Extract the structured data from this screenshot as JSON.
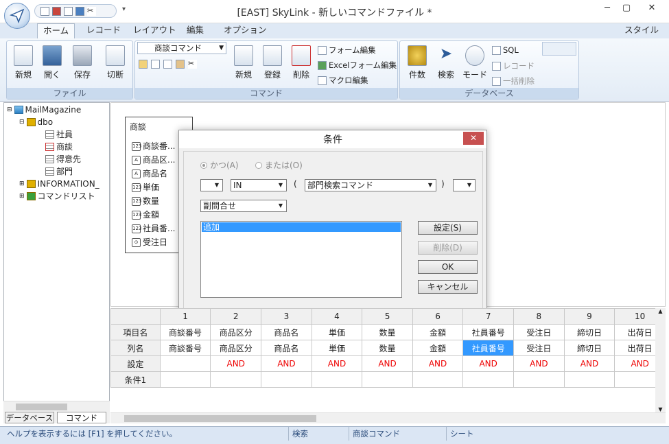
{
  "window": {
    "title": "[EAST] SkyLink - 新しいコマンドファイル *"
  },
  "ribbon_tabs": [
    "ホーム",
    "レコード",
    "レイアウト",
    "編集",
    "オプション"
  ],
  "style_menu": "スタイル",
  "groups": {
    "file": {
      "label": "ファイル",
      "buttons": [
        "新規",
        "開く",
        "保存",
        "切断"
      ]
    },
    "command": {
      "label": "コマンド",
      "combo": "商談コマンド",
      "buttons": [
        "新規",
        "登録",
        "削除"
      ],
      "links": [
        "フォーム編集",
        "Excelフォーム編集",
        "マクロ編集"
      ]
    },
    "database": {
      "label": "データベース",
      "buttons": [
        "件数",
        "検索",
        "モード"
      ],
      "links": [
        "SQL",
        "レコード",
        "一括削除"
      ]
    }
  },
  "tree": {
    "root": "MailMagazine",
    "schema": "dbo",
    "tables": [
      "社員",
      "商談",
      "得意先",
      "部門"
    ],
    "others": [
      "INFORMATION_",
      "コマンドリスト"
    ]
  },
  "left_tabs": [
    "データベース",
    "コマンド"
  ],
  "table_box": {
    "title": "商談",
    "fields": [
      {
        "icon": "123",
        "name": "商談番..."
      },
      {
        "icon": "A",
        "name": "商品区..."
      },
      {
        "icon": "A",
        "name": "商品名"
      },
      {
        "icon": "123",
        "name": "単価"
      },
      {
        "icon": "123",
        "name": "数量"
      },
      {
        "icon": "123",
        "name": "金額"
      },
      {
        "icon": "123",
        "name": "社員番..."
      },
      {
        "icon": "date",
        "name": "受注日"
      }
    ]
  },
  "dialog": {
    "title": "条件",
    "close": "✕",
    "radio_and": "かつ(A)",
    "radio_or": "または(O)",
    "open_paren": "(",
    "close_paren": ")",
    "operator": "IN",
    "target": "部門検索コマンド",
    "subquery": "副問合せ",
    "list_items": [
      "追加"
    ],
    "buttons": {
      "set": "設定(S)",
      "delete": "削除(D)",
      "ok": "OK",
      "cancel": "キャンセル"
    }
  },
  "grid": {
    "columns": [
      "1",
      "2",
      "3",
      "4",
      "5",
      "6",
      "7",
      "8",
      "9",
      "10"
    ],
    "row_labels": [
      "項目名",
      "列名",
      "設定",
      "条件1"
    ],
    "item_names": [
      "商談番号",
      "商品区分",
      "商品名",
      "単価",
      "数量",
      "金額",
      "社員番号",
      "受注日",
      "締切日",
      "出荷日"
    ],
    "col_names": [
      "商談番号",
      "商品区分",
      "商品名",
      "単価",
      "数量",
      "金額",
      "社員番号",
      "受注日",
      "締切日",
      "出荷日"
    ],
    "settings": [
      "",
      "AND",
      "AND",
      "AND",
      "AND",
      "AND",
      "AND",
      "AND",
      "AND",
      "AND"
    ]
  },
  "status": {
    "help": "ヘルプを表示するには [F1] を押してください。",
    "mode": "検索",
    "command": "商談コマンド",
    "view": "シート"
  },
  "colors": {
    "accent": "#3399ff",
    "ribbon": "#dfe9f5",
    "and_red": "#e00000"
  }
}
